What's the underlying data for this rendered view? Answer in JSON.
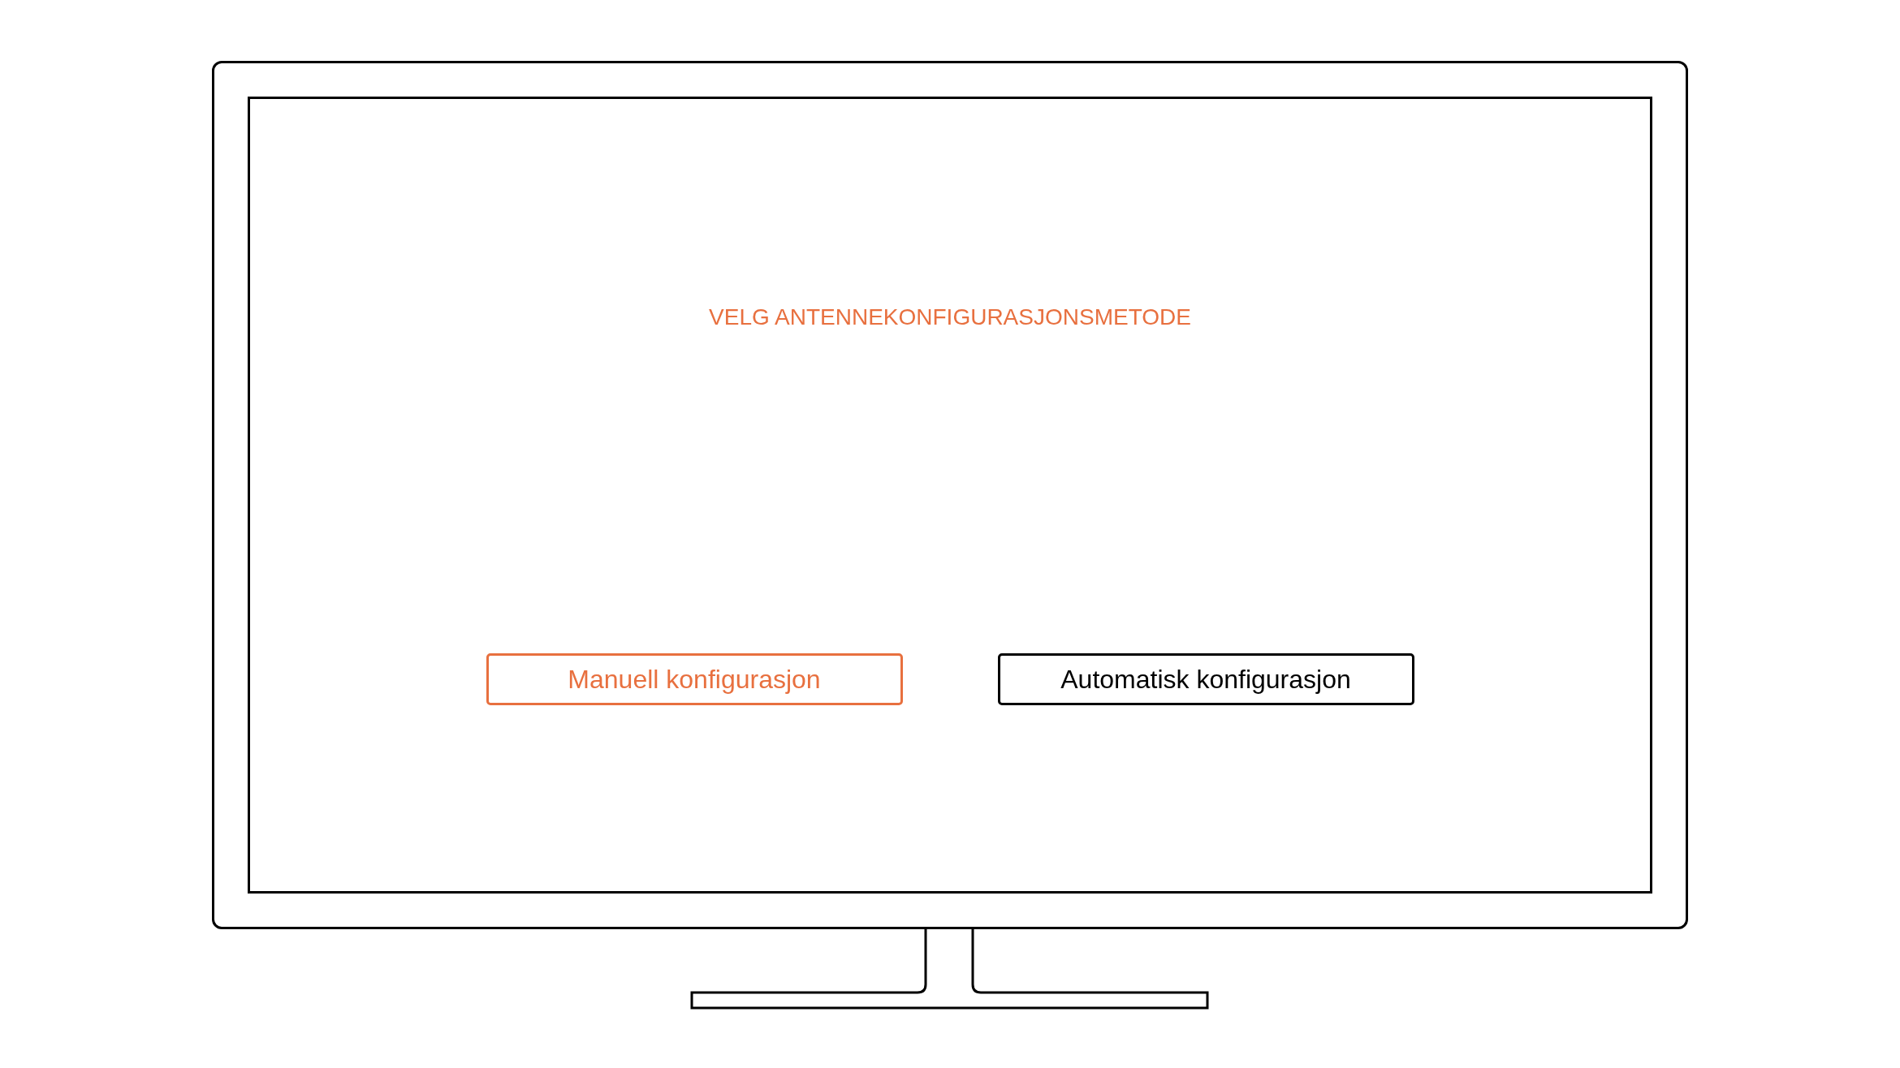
{
  "screen": {
    "title": "VELG ANTENNEKONFIGURASJONSMETODE",
    "options": [
      {
        "label": "Manuell konfigurasjon",
        "selected": true
      },
      {
        "label": "Automatisk konfigurasjon",
        "selected": false
      }
    ]
  }
}
